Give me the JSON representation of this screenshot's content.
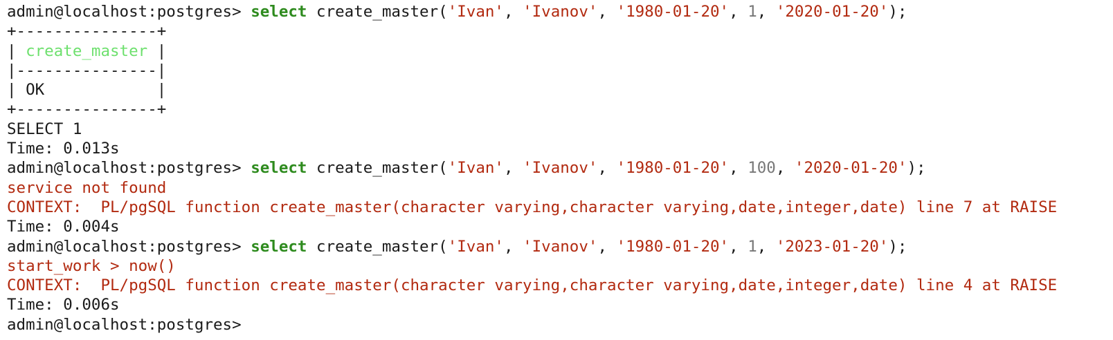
{
  "terminal": {
    "prompt": "admin@localhost:postgres> ",
    "commands": [
      {
        "keyword": "select",
        "func_open": " create_master(",
        "args": [
          {
            "type": "str",
            "text": "'Ivan'"
          },
          {
            "type": "str",
            "text": "'Ivanov'"
          },
          {
            "type": "str",
            "text": "'1980-01-20'"
          },
          {
            "type": "num",
            "text": "1"
          },
          {
            "type": "str",
            "text": "'2020-01-20'"
          }
        ],
        "close": ");"
      },
      {
        "keyword": "select",
        "func_open": " create_master(",
        "args": [
          {
            "type": "str",
            "text": "'Ivan'"
          },
          {
            "type": "str",
            "text": "'Ivanov'"
          },
          {
            "type": "str",
            "text": "'1980-01-20'"
          },
          {
            "type": "num",
            "text": "100"
          },
          {
            "type": "str",
            "text": "'2020-01-20'"
          }
        ],
        "close": ");"
      },
      {
        "keyword": "select",
        "func_open": " create_master(",
        "args": [
          {
            "type": "str",
            "text": "'Ivan'"
          },
          {
            "type": "str",
            "text": "'Ivanov'"
          },
          {
            "type": "str",
            "text": "'1980-01-20'"
          },
          {
            "type": "num",
            "text": "1"
          },
          {
            "type": "str",
            "text": "'2023-01-20'"
          }
        ],
        "close": ");"
      }
    ],
    "arg_separator": ", ",
    "result_table": {
      "border_top": "+---------------+",
      "header_left": "| ",
      "header": "create_master",
      "header_right": " |",
      "separator": "|---------------|",
      "row": "| OK            |",
      "border_bottom": "+---------------+"
    },
    "select_status": "SELECT 1",
    "time_1": "Time: 0.013s",
    "error_1": "service not found",
    "context_1": "CONTEXT:  PL/pgSQL function create_master(character varying,character varying,date,integer,date) line 7 at RAISE",
    "time_2": "Time: 0.004s",
    "error_2": "start_work > now()",
    "context_2": "CONTEXT:  PL/pgSQL function create_master(character varying,character varying,date,integer,date) line 4 at RAISE",
    "time_3": "Time: 0.006s",
    "final_prompt": "admin@localhost:postgres>"
  },
  "colors": {
    "keyword": "#2e8b1e",
    "string": "#b22a10",
    "number": "#777777",
    "header": "#6ee06e",
    "error": "#b22a10",
    "text": "#1a1a1a",
    "background": "#ffffff"
  }
}
